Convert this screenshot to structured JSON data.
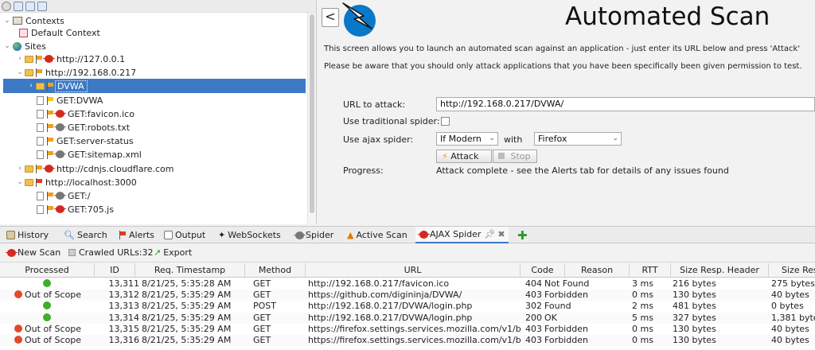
{
  "tree": {
    "contexts_label": "Contexts",
    "default_context_label": "Default Context",
    "sites_label": "Sites",
    "nodes": [
      {
        "label": "http://127.0.0.1"
      },
      {
        "label": "http://192.168.0.217"
      },
      {
        "label": "DVWA"
      },
      {
        "label": "GET:DVWA"
      },
      {
        "label": "GET:favicon.ico"
      },
      {
        "label": "GET:robots.txt"
      },
      {
        "label": "GET:server-status"
      },
      {
        "label": "GET:sitemap.xml"
      },
      {
        "label": "http://cdnjs.cloudflare.com"
      },
      {
        "label": "http://localhost:3000"
      },
      {
        "label": "GET:/"
      },
      {
        "label": "GET:705.js"
      }
    ]
  },
  "scan": {
    "back_label": "<",
    "title": "Automated Scan",
    "intro": "This screen allows you to launch an automated scan against  an application - just enter its URL below and press 'Attack'",
    "warning": "Please be aware that you should only attack applications that you have been specifically been given permission to test.",
    "url_label": "URL to attack:",
    "url_value": "http://192.168.0.217/DVWA/",
    "traditional_label": "Use traditional spider:",
    "ajax_label": "Use ajax spider:",
    "ajax_mode": "If Modern",
    "with_label": "with",
    "browser": "Firefox",
    "attack_label": "Attack",
    "stop_label": "Stop",
    "progress_label": "Progress:",
    "progress_text": "Attack complete - see the Alerts tab for details of any issues found"
  },
  "tabs": [
    "History",
    "Search",
    "Alerts",
    "Output",
    "WebSockets",
    "Spider",
    "Active Scan",
    "AJAX Spider"
  ],
  "spider_toolbar": {
    "new_scan": "New Scan",
    "crawled": "Crawled URLs:32",
    "export": "Export"
  },
  "table": {
    "headers": [
      "Processed",
      "ID",
      "Req. Timestamp",
      "Method",
      "URL",
      "Code",
      "Reason",
      "RTT",
      "Size Resp. Header",
      "Size Resp. Body"
    ],
    "rows": [
      {
        "processed": "",
        "status": "ok",
        "id": "13,311",
        "ts": "8/21/25, 5:35:28 AM",
        "method": "GET",
        "url": "http://192.168.0.217/favicon.ico",
        "code": "404",
        "reason": "Not Found",
        "rtt": "3 ms",
        "hdr": "216 bytes",
        "body": "275 bytes"
      },
      {
        "processed": "Out of Scope",
        "status": "out",
        "id": "13,312",
        "ts": "8/21/25, 5:35:29 AM",
        "method": "GET",
        "url": "https://github.com/digininja/DVWA/",
        "code": "403",
        "reason": "Forbidden",
        "rtt": "0 ms",
        "hdr": "130 bytes",
        "body": "40 bytes"
      },
      {
        "processed": "",
        "status": "ok",
        "id": "13,313",
        "ts": "8/21/25, 5:35:29 AM",
        "method": "POST",
        "url": "http://192.168.0.217/DVWA/login.php",
        "code": "302",
        "reason": "Found",
        "rtt": "2 ms",
        "hdr": "481 bytes",
        "body": "0 bytes"
      },
      {
        "processed": "",
        "status": "ok",
        "id": "13,314",
        "ts": "8/21/25, 5:35:29 AM",
        "method": "GET",
        "url": "http://192.168.0.217/DVWA/login.php",
        "code": "200",
        "reason": "OK",
        "rtt": "5 ms",
        "hdr": "327 bytes",
        "body": "1,381 bytes"
      },
      {
        "processed": "Out of Scope",
        "status": "out",
        "id": "13,315",
        "ts": "8/21/25, 5:35:29 AM",
        "method": "GET",
        "url": "https://firefox.settings.services.mozilla.com/v1/b...",
        "code": "403",
        "reason": "Forbidden",
        "rtt": "0 ms",
        "hdr": "130 bytes",
        "body": "40 bytes"
      },
      {
        "processed": "Out of Scope",
        "status": "out",
        "id": "13,316",
        "ts": "8/21/25, 5:35:29 AM",
        "method": "GET",
        "url": "https://firefox.settings.services.mozilla.com/v1/b...",
        "code": "403",
        "reason": "Forbidden",
        "rtt": "0 ms",
        "hdr": "130 bytes",
        "body": "40 bytes"
      }
    ]
  },
  "colors": {
    "selection": "#3d79c4",
    "ok_dot": "#3fae2a",
    "out_dot": "#e04a2a"
  }
}
